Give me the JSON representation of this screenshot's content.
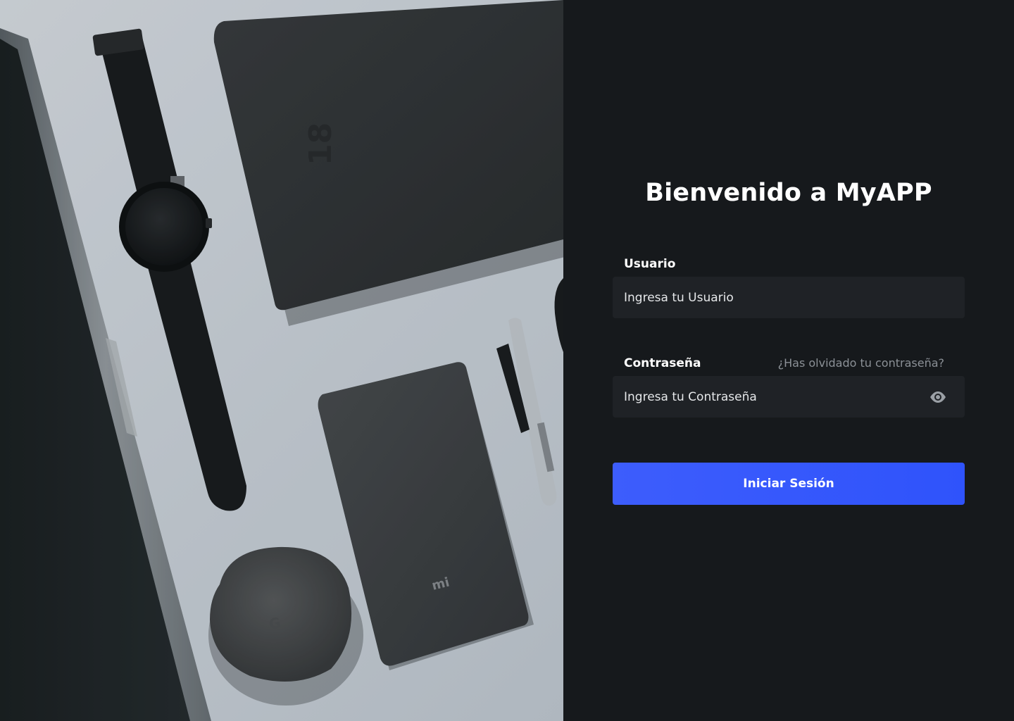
{
  "login": {
    "title": "Bienvenido a MyAPP",
    "username": {
      "label": "Usuario",
      "placeholder": "Ingresa tu Usuario"
    },
    "password": {
      "label": "Contraseña",
      "placeholder": "Ingresa tu Contraseña",
      "forgot_link": "¿Has olvidado tu contraseña?",
      "toggle_icon": "eye-icon"
    },
    "submit_label": "Iniciar Sesión"
  },
  "hero_image": {
    "notebook_print": "18",
    "powerbank_logo": "mi",
    "case_logo": "G"
  },
  "colors": {
    "background": "#16191c",
    "input_background": "#1f2226",
    "accent": "#3357fb",
    "muted_text": "#8b9096"
  }
}
